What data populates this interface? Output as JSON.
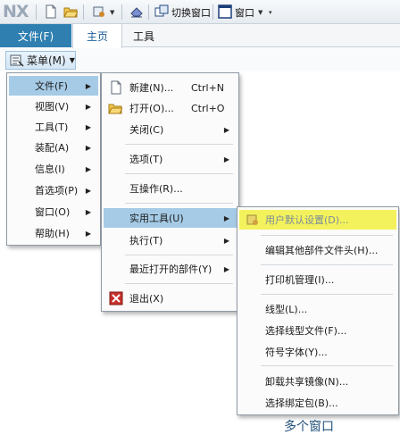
{
  "app": {
    "logo": "NX",
    "switch_window_label": "切换窗口",
    "window_label": "窗口"
  },
  "ribbon": {
    "file_tab": "文件(F)",
    "tabs": [
      "主页",
      "工具"
    ]
  },
  "menu_button": {
    "label": "菜单(M)"
  },
  "menu_main": [
    {
      "label": "文件(F)",
      "highlighted": true
    },
    {
      "label": "视图(V)"
    },
    {
      "label": "工具(T)"
    },
    {
      "label": "装配(A)"
    },
    {
      "label": "信息(I)"
    },
    {
      "label": "首选项(P)"
    },
    {
      "label": "窗口(O)"
    },
    {
      "label": "帮助(H)"
    }
  ],
  "menu_file": {
    "new": {
      "label": "新建(N)...",
      "shortcut": "Ctrl+N",
      "icon": "new-file-icon"
    },
    "open": {
      "label": "打开(O)...",
      "shortcut": "Ctrl+O",
      "icon": "open-folder-icon"
    },
    "close": {
      "label": "关闭(C)"
    },
    "options": {
      "label": "选项(T)"
    },
    "interop": {
      "label": "互操作(R)..."
    },
    "utilities": {
      "label": "实用工具(U)",
      "highlighted": true
    },
    "execute": {
      "label": "执行(T)"
    },
    "recent": {
      "label": "最近打开的部件(Y)"
    },
    "exit": {
      "label": "退出(X)",
      "icon": "exit-icon"
    }
  },
  "menu_utilities": {
    "user_defaults": {
      "label": "用户默认设置(D)...",
      "highlighted": true
    },
    "edit_header": {
      "label": "编辑其他部件文件头(H)..."
    },
    "printer_mgmt": {
      "label": "打印机管理(I)..."
    },
    "linetype": {
      "label": "线型(L)..."
    },
    "select_linetype_file": {
      "label": "选择线型文件(F)..."
    },
    "symbol_font": {
      "label": "符号字体(Y)..."
    },
    "unload_image": {
      "label": "卸载共享镜像(N)..."
    },
    "select_bind_pkg": {
      "label": "选择绑定包(B)..."
    }
  },
  "background": {
    "multi_window": "多个窗口"
  },
  "colors": {
    "accent": "#2f7fb1",
    "highlight": "#a6cbe6",
    "marker": "#f4f25c"
  }
}
